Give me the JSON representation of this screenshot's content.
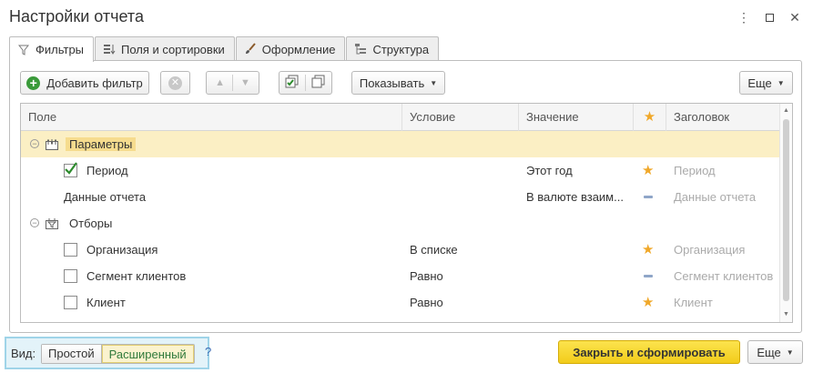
{
  "window": {
    "title": "Настройки отчета"
  },
  "tabs": [
    {
      "label": "Фильтры",
      "icon": "filter-icon",
      "active": true
    },
    {
      "label": "Поля и сортировки",
      "icon": "fields-sort-icon",
      "active": false
    },
    {
      "label": "Оформление",
      "icon": "brush-icon",
      "active": false
    },
    {
      "label": "Структура",
      "icon": "structure-icon",
      "active": false
    }
  ],
  "toolbar": {
    "add_filter": "Добавить фильтр",
    "show": "Показывать",
    "more": "Еще"
  },
  "table": {
    "columns": [
      "Поле",
      "Условие",
      "Значение",
      "",
      "Заголовок"
    ],
    "rows": [
      {
        "field": "Параметры",
        "condition": "",
        "value": "",
        "title": "",
        "group": true,
        "selected": true
      },
      {
        "field": "Период",
        "condition": "",
        "value": "Этот год",
        "title": "Период",
        "checked": true,
        "mark": "star"
      },
      {
        "field": "Данные отчета",
        "condition": "",
        "value": "В валюте взаим...",
        "title": "Данные отчета",
        "mark": "dash"
      },
      {
        "field": "Отборы",
        "condition": "",
        "value": "",
        "title": "",
        "group": true
      },
      {
        "field": "Организация",
        "condition": "В списке",
        "value": "",
        "title": "Организация",
        "checked": false,
        "mark": "star"
      },
      {
        "field": "Сегмент клиентов",
        "condition": "Равно",
        "value": "",
        "title": "Сегмент клиентов",
        "checked": false,
        "mark": "dash"
      },
      {
        "field": "Клиент",
        "condition": "Равно",
        "value": "",
        "title": "Клиент",
        "checked": false,
        "mark": "star"
      }
    ]
  },
  "footer": {
    "view_label": "Вид:",
    "mode_simple": "Простой",
    "mode_extended": "Расширенный",
    "help": "?",
    "primary": "Закрыть и сформировать",
    "more": "Еще"
  },
  "colors": {
    "accent_yellow": "#f2cc1b",
    "selection": "#fbefc4",
    "star": "#f0a82a",
    "view_highlight": "#9fd4e8"
  }
}
